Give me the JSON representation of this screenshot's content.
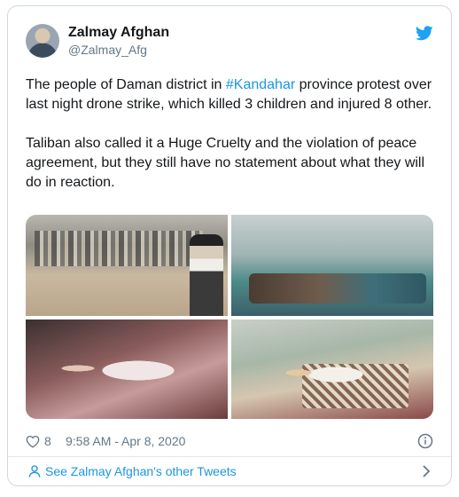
{
  "tweet": {
    "author": {
      "display_name": "Zalmay Afghan",
      "handle": "@Zalmay_Afg",
      "avatar_icon": "user-avatar"
    },
    "brand_icon": "twitter-bird-icon",
    "brand_color": "#1da1f2",
    "text": {
      "p1_before": "The people of Daman district in ",
      "p1_hashtag": "#Kandahar",
      "p1_after": " province protest over last night drone strike, which killed 3 children and injured 8 other.",
      "p2": "Taliban also called it a Huge Cruelty and the violation of peace agreement, but they still have no statement about what they will do in reaction."
    },
    "media": [
      {
        "description": "crowd-photo"
      },
      {
        "description": "hospital-bed-photo"
      },
      {
        "description": "injured-child-photo"
      },
      {
        "description": "child-on-bed-photo"
      }
    ],
    "likes": "8",
    "timestamp": "9:58 AM - Apr 8, 2020",
    "footer_link": "See Zalmay Afghan's other Tweets",
    "link_color": "#1b95e0",
    "muted_color": "#657786"
  }
}
